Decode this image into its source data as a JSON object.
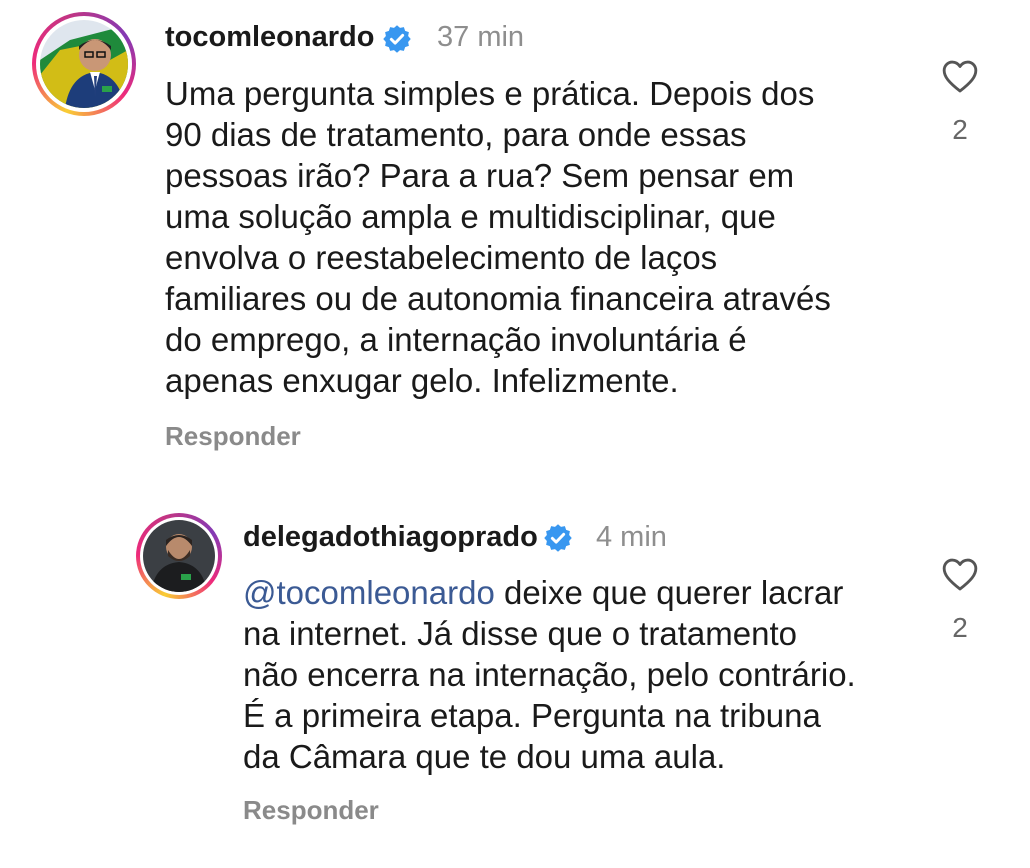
{
  "comments": [
    {
      "username": "tocomleonardo",
      "time": "37 min",
      "lines": [
        "Uma pergunta simples e prática. Depois dos",
        "90 dias de tratamento, para onde essas",
        "pessoas irão? Para a rua? Sem pensar em",
        "uma solução ampla e multidisciplinar, que",
        "envolva o reestabelecimento de laços",
        "familiares ou de autonomia financeira através",
        "do emprego, a internação involuntária é",
        "apenas enxugar gelo. Infelizmente."
      ],
      "reply_label": "Responder",
      "like_count": "2",
      "avatar_icon": "profile-photo-man-suit",
      "verified_icon": "verified-badge-icon"
    },
    {
      "username": "delegadothiagoprado",
      "time": "4 min",
      "mention": "@tocomleonardo",
      "first_line_rest": " deixe que querer lacrar",
      "lines": [
        "na internet. Já disse que o tratamento",
        "não encerra na internação, pelo contrário.",
        "É a primeira etapa. Pergunta na tribuna",
        "da Câmara que te dou uma aula."
      ],
      "reply_label": "Responder",
      "like_count": "2",
      "avatar_icon": "profile-photo-man-dark-jacket",
      "verified_icon": "verified-badge-icon"
    }
  ],
  "colors": {
    "verified": "#3897f0",
    "mention": "#3b5a94",
    "meta": "#8e8e8e"
  }
}
